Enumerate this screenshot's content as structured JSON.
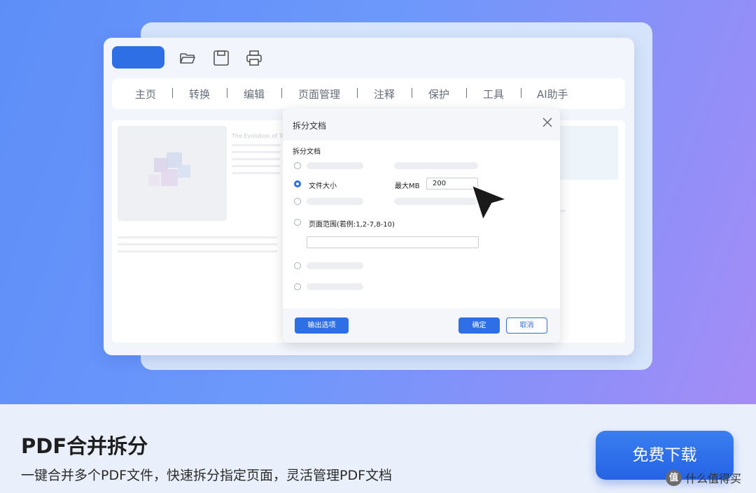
{
  "toolbar": {
    "icons": [
      "folder-open-icon",
      "save-icon",
      "print-icon"
    ]
  },
  "menu": {
    "items": [
      "主页",
      "转换",
      "编辑",
      "页面管理",
      "注释",
      "保护",
      "工具",
      "AI助手"
    ],
    "separator": "|"
  },
  "document": {
    "title_snippet": "The Evolution of Te"
  },
  "dialog": {
    "title": "拆分文档",
    "section_label": "拆分文档",
    "options": {
      "file_size_label": "文件大小",
      "max_mb_label": "最大MB",
      "max_mb_value": "200",
      "page_range_label": "页面范围(若例:1,2-7,8-10)",
      "page_range_value": ""
    },
    "selected_option": "file_size",
    "buttons": {
      "output_options": "输出选项",
      "confirm": "确定",
      "cancel": "取消"
    }
  },
  "footer": {
    "feature_title": "PDF合并拆分",
    "feature_subtitle": "一键合并多个PDF文件，快速拆分指定页面，灵活管理PDF文档",
    "download_button": "免费下载"
  },
  "watermark": {
    "icon_text": "值",
    "text": "什么值得买"
  },
  "colors": {
    "accent": "#2f6fe6",
    "hero_gradient_start": "#5d8ef8",
    "hero_gradient_end": "#a58cf6",
    "footer_bg": "#eaf0fb"
  }
}
